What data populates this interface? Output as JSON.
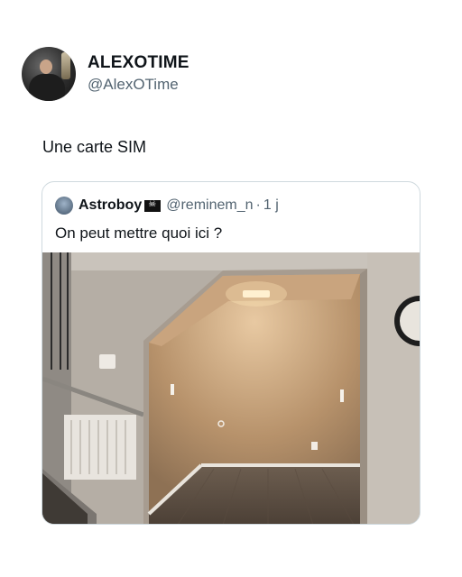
{
  "author": {
    "display_name": "ALEXOTIME",
    "handle": "@AlexOTime",
    "avatar_icon": "person-avatar"
  },
  "tweet": {
    "text": "Une carte SIM"
  },
  "quote": {
    "display_name": "Astroboy",
    "flag_icon": "pirate-flag-icon",
    "handle": "@reminem_n",
    "separator": "·",
    "time": "1 j",
    "text": "On peut mettre quoi ici ?"
  },
  "colors": {
    "text": "#0f1419",
    "secondary": "#536471",
    "border": "#cfd9de"
  }
}
